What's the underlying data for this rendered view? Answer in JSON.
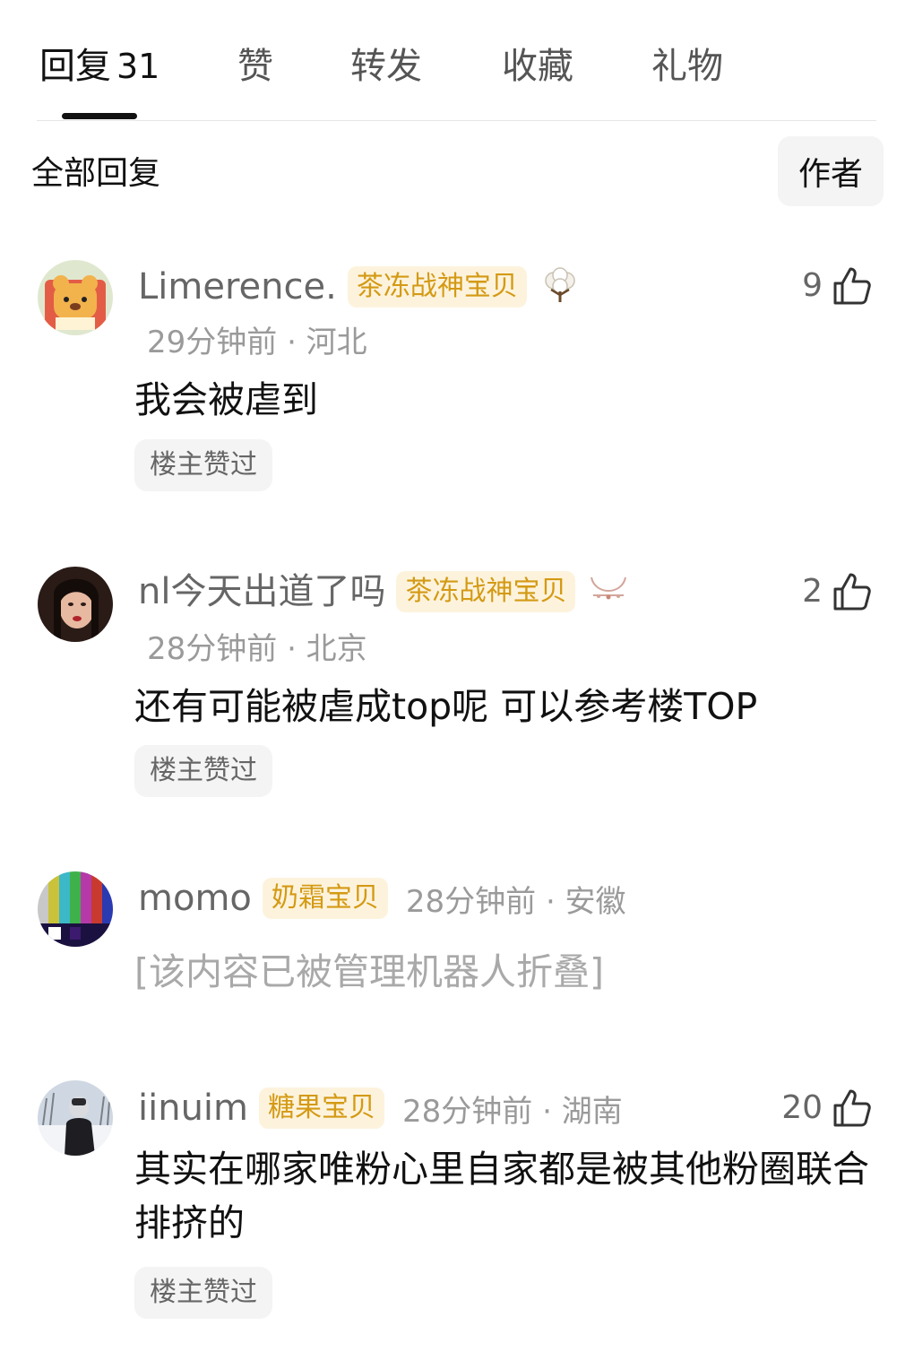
{
  "tabs": [
    {
      "label": "回复",
      "count": "31"
    },
    {
      "label": "赞"
    },
    {
      "label": "转发"
    },
    {
      "label": "收藏"
    },
    {
      "label": "礼物"
    }
  ],
  "sort": {
    "all_label": "全部回复",
    "author_label": "作者"
  },
  "comments": [
    {
      "username": "Limerence.",
      "badge": "茶冻战神宝贝",
      "decoration": "cotton-flower-icon",
      "time": "29分钟前",
      "location": "河北",
      "meta": "29分钟前 · 河北",
      "content": "我会被虐到",
      "likes": "9",
      "op_liked": "楼主赞过"
    },
    {
      "username": "nl今天出道了吗",
      "badge": "茶冻战神宝贝",
      "decoration": "necklace-icon",
      "time": "28分钟前",
      "location": "北京",
      "meta": "28分钟前 · 北京",
      "content": "还有可能被虐成top呢 可以参考楼TOP",
      "likes": "2",
      "op_liked": "楼主赞过"
    },
    {
      "username": "momo",
      "badge": "奶霜宝贝",
      "time": "28分钟前",
      "location": "安徽",
      "meta": "28分钟前 · 安徽",
      "content": "[该内容已被管理机器人折叠]"
    },
    {
      "username": "iinuim",
      "badge": "糖果宝贝",
      "time": "28分钟前",
      "location": "湖南",
      "meta": "28分钟前 · 湖南",
      "content": "其实在哪家唯粉心里自家都是被其他粉圈联合排挤的",
      "likes": "20",
      "op_liked": "楼主赞过"
    }
  ],
  "colors": {
    "badge_bg": "#fdf3dd",
    "badge_text": "#d49a14",
    "meta": "#9a9a9a"
  },
  "icons": {
    "like": "thumbs-up-icon"
  }
}
